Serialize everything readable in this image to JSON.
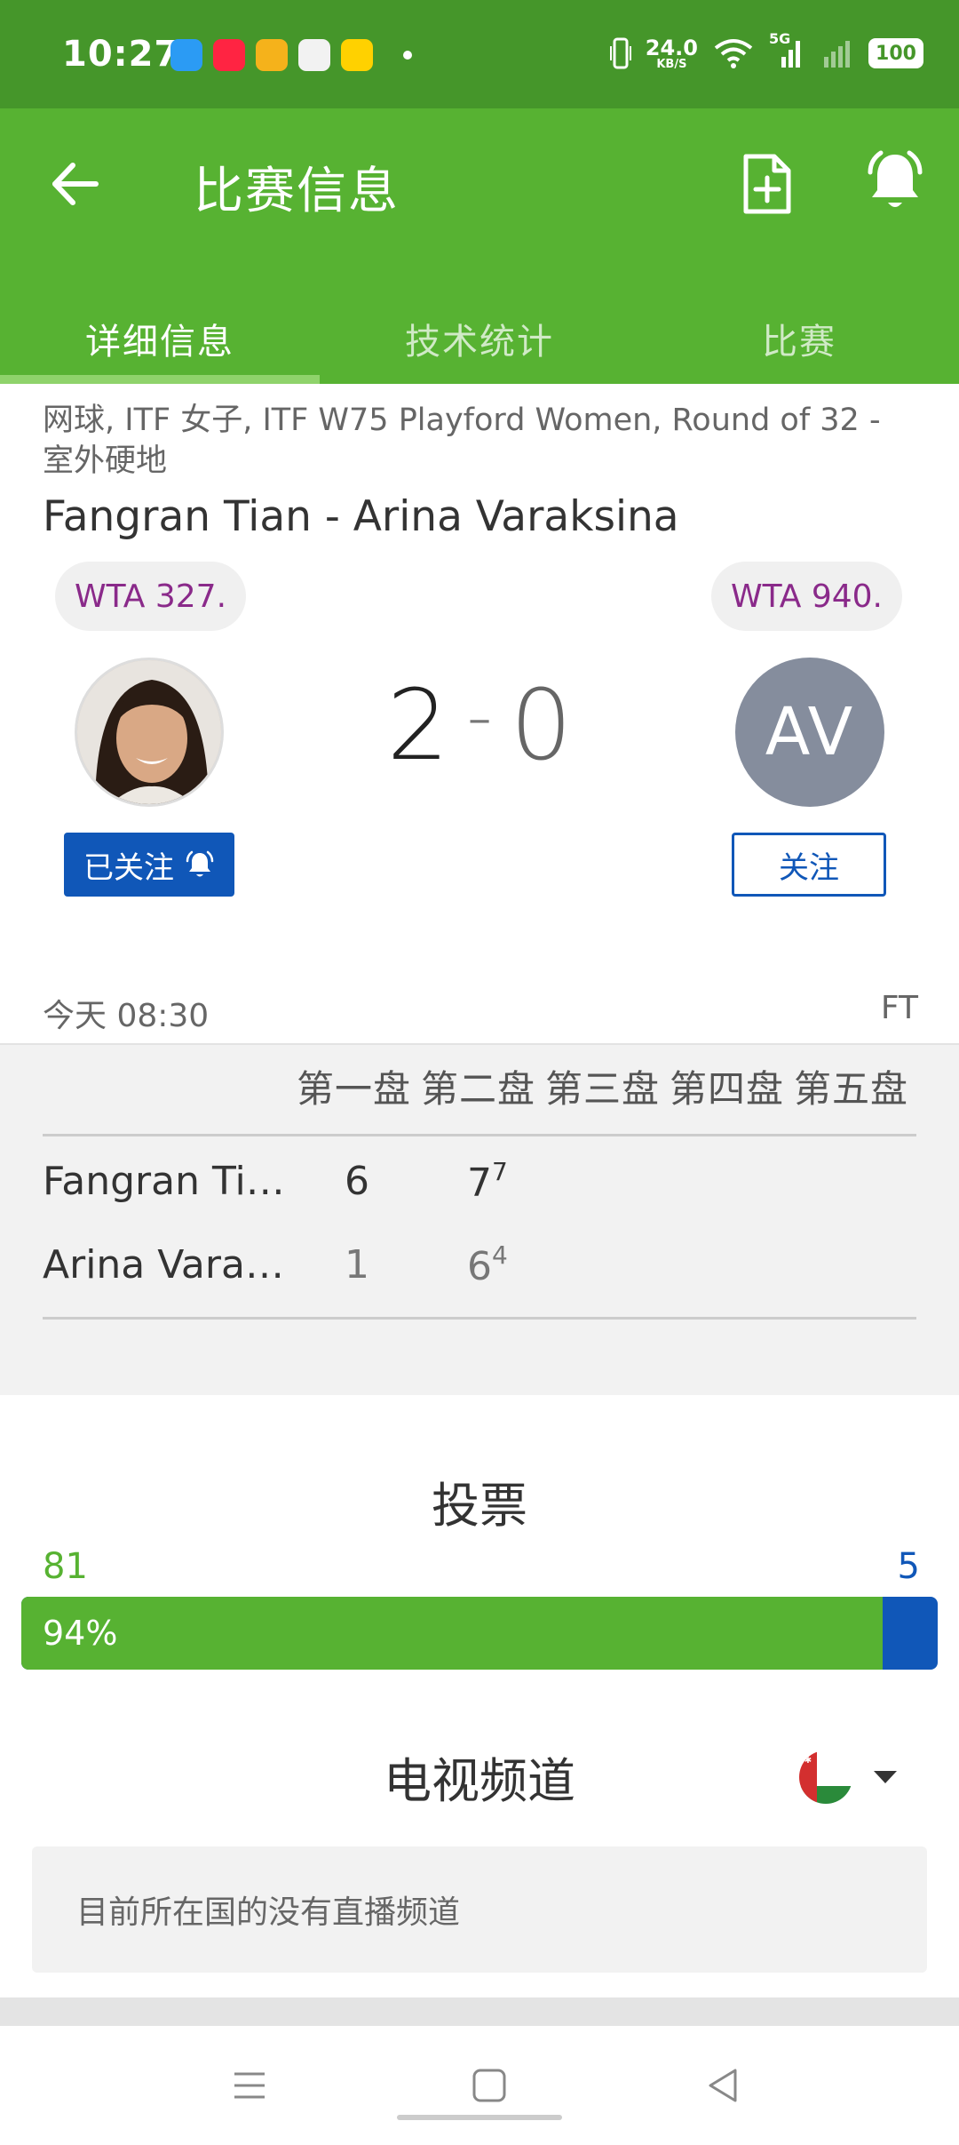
{
  "status_bar": {
    "time": "10:27",
    "speed": "24.0",
    "speed_unit": "KB/S",
    "network": "5G",
    "battery": "100"
  },
  "header": {
    "title": "比赛信息",
    "tabs": [
      {
        "label": "详细信息",
        "active": true
      },
      {
        "label": "技术统计",
        "active": false
      },
      {
        "label": "比赛",
        "active": false
      }
    ]
  },
  "match": {
    "meta": "网球, ITF 女子, ITF W75 Playford Women, Round of 32 - 室外硬地",
    "title": "Fangran Tian - Arina Varaksina",
    "player1": {
      "rank": "WTA 327.",
      "follow_label": "已关注",
      "following": true
    },
    "player2": {
      "rank": "WTA 940.",
      "initials": "AV",
      "follow_label": "关注",
      "following": false
    },
    "score_home": "2",
    "score_sep": "-",
    "score_away": "0",
    "date_time": "今天 08:30",
    "status": "FT"
  },
  "sets_table": {
    "headers": [
      "第一盘",
      "第二盘",
      "第三盘",
      "第四盘",
      "第五盘"
    ],
    "rows": [
      {
        "name": "Fangran Tian",
        "set1": "6",
        "set2": "7",
        "set2_tb": "7"
      },
      {
        "name": "Arina Varaksina",
        "set1": "1",
        "set2": "6",
        "set2_tb": "4"
      }
    ]
  },
  "vote": {
    "title": "投票",
    "home_votes": "81",
    "away_votes": "5",
    "home_pct_label": "94%",
    "home_pct": 94,
    "home_color": "#57b232",
    "away_color": "#1057b8"
  },
  "tv": {
    "title": "电视频道",
    "message": "目前所在国的没有直播频道"
  },
  "colors": {
    "status_bar": "#45962a",
    "app_bar": "#57b232",
    "follow_blue": "#1057b8",
    "rank_text": "#8a2a8a"
  }
}
